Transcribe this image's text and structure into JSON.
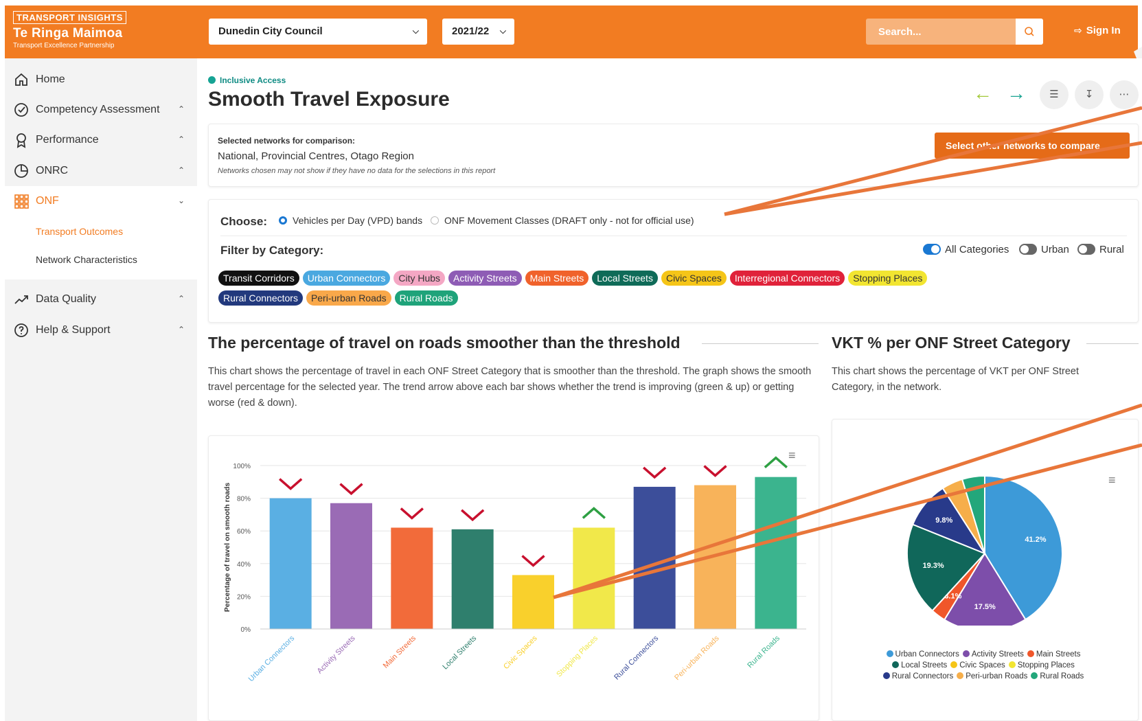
{
  "header": {
    "logo_line1": "TRANSPORT INSIGHTS",
    "logo_line2": "Te Ringa Maimoa",
    "logo_line3": "Transport Excellence Partnership",
    "council_select": "Dunedin City Council",
    "year_select": "2021/22",
    "search_placeholder": "Search...",
    "signin_label": "Sign In"
  },
  "sidebar": {
    "home": "Home",
    "competency": "Competency Assessment",
    "performance": "Performance",
    "onrc": "ONRC",
    "onf": "ONF",
    "sub_transport": "Transport Outcomes",
    "sub_network": "Network Characteristics",
    "data_quality": "Data Quality",
    "help": "Help & Support"
  },
  "page": {
    "breadcrumb": "Inclusive Access",
    "title": "Smooth Travel Exposure"
  },
  "networks": {
    "heading": "Selected networks for comparison:",
    "list": "National, Provincial Centres, Otago Region",
    "note": "Networks chosen may not show if they have no data for the selections in this report",
    "compare_button": "Select other networks to compare"
  },
  "filters": {
    "choose_label": "Choose:",
    "radio_vpd": "Vehicles per Day (VPD) bands",
    "radio_onf": "ONF Movement Classes (DRAFT only - not for official use)",
    "filter_label": "Filter by Category:",
    "toggle_all": "All Categories",
    "toggle_urban": "Urban",
    "toggle_rural": "Rural",
    "chips": [
      {
        "label": "Transit Corridors",
        "color": "#111111"
      },
      {
        "label": "Urban Connectors",
        "color": "#4aa8e0"
      },
      {
        "label": "City Hubs",
        "color": "#f4a7c4"
      },
      {
        "label": "Activity Streets",
        "color": "#8e5cb5"
      },
      {
        "label": "Main Streets",
        "color": "#f0622b"
      },
      {
        "label": "Local Streets",
        "color": "#0f6b58"
      },
      {
        "label": "Civic Spaces",
        "color": "#f5c518"
      },
      {
        "label": "Interregional Connectors",
        "color": "#e0223a"
      },
      {
        "label": "Stopping Places",
        "color": "#f2e531"
      },
      {
        "label": "Rural Connectors",
        "color": "#22397d"
      },
      {
        "label": "Peri-urban Roads",
        "color": "#f9a84a"
      },
      {
        "label": "Rural Roads",
        "color": "#1fa37a"
      }
    ]
  },
  "bar_section": {
    "title": "The percentage of travel on roads smoother than the threshold",
    "description": "This chart shows the percentage of travel in each ONF Street Category that is smoother than the threshold. The graph shows the smooth travel percentage for the selected year. The trend arrow above each bar shows whether the trend is improving (green & up) or getting worse (red & down)."
  },
  "pie_section": {
    "title": "VKT % per ONF Street Category",
    "description": "This chart shows the percentage of VKT per ONF Street Category, in the network."
  },
  "chart_data": [
    {
      "type": "bar",
      "ylabel": "Percentage of travel on smooth roads",
      "ylim": [
        0,
        100
      ],
      "yticks": [
        "0%",
        "20%",
        "40%",
        "60%",
        "80%",
        "100%"
      ],
      "grid": true,
      "categories": [
        "Urban Connectors",
        "Activity Streets",
        "Main Streets",
        "Local Streets",
        "Civic Spaces",
        "Stopping Places",
        "Rural Connectors",
        "Peri-urban Roads",
        "Rural Roads"
      ],
      "values": [
        80,
        77,
        62,
        61,
        33,
        62,
        87,
        88,
        93
      ],
      "trend": [
        "down",
        "down",
        "down",
        "down",
        "down",
        "up",
        "down",
        "down",
        "up"
      ],
      "colors": [
        "#5aafe3",
        "#9a6bb5",
        "#f26b3a",
        "#2f7f6d",
        "#f9d02c",
        "#f1e84a",
        "#3c4e9a",
        "#f8b35a",
        "#3bb48e"
      ]
    },
    {
      "type": "pie",
      "labels": [
        "Urban Connectors",
        "Activity Streets",
        "Main Streets",
        "Local Streets",
        "Civic Spaces",
        "Stopping Places",
        "Rural Connectors",
        "Peri-urban Roads",
        "Rural Roads"
      ],
      "values": [
        41.2,
        17.5,
        3.1,
        19.3,
        0,
        0,
        9.8,
        4.4,
        4.7
      ],
      "slice_labels": [
        "41.2%",
        "17.5%",
        "3.1%",
        "19.3%",
        "",
        "",
        "9.8%",
        "",
        ""
      ],
      "colors": [
        "#3d9ad8",
        "#7d4eaa",
        "#f0562a",
        "#10675a",
        "#f5c518",
        "#f2e531",
        "#283a8a",
        "#f6ae4a",
        "#23a77b"
      ],
      "legend_position": "bottom"
    }
  ]
}
